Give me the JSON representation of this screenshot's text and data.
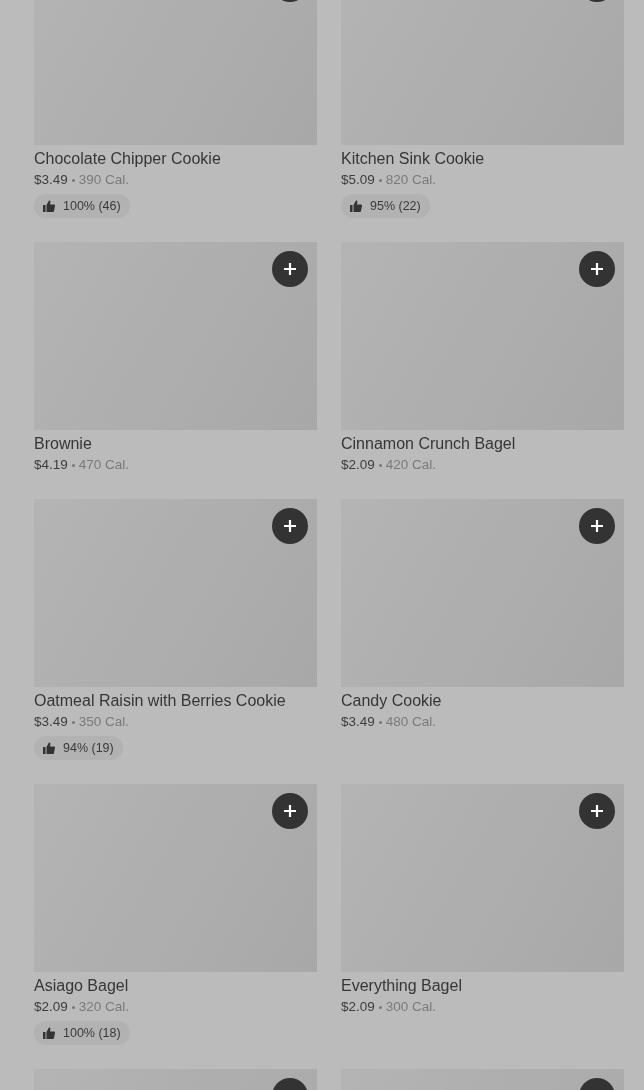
{
  "menu_items": [
    {
      "kind": "full",
      "name": "Chocolate Chipper Cookie",
      "price": "$3.49",
      "calories": "390 Cal.",
      "rating": "100% (46)"
    },
    {
      "kind": "full",
      "name": "Kitchen Sink Cookie",
      "price": "$5.09",
      "calories": "820 Cal.",
      "rating": "95% (22)"
    },
    {
      "kind": "full",
      "name": "Brownie",
      "price": "$4.19",
      "calories": "470 Cal."
    },
    {
      "kind": "full",
      "name": "Cinnamon Crunch Bagel",
      "price": "$2.09",
      "calories": "420 Cal."
    },
    {
      "kind": "full",
      "name": "Oatmeal Raisin with Berries Cookie",
      "price": "$3.49",
      "calories": "350 Cal.",
      "rating": "94% (19)"
    },
    {
      "kind": "full",
      "name": "Candy Cookie",
      "price": "$3.49",
      "calories": "480 Cal."
    },
    {
      "kind": "full",
      "name": "Asiago Bagel",
      "price": "$2.09",
      "calories": "320 Cal.",
      "rating": "100% (18)"
    },
    {
      "kind": "full",
      "name": "Everything Bagel",
      "price": "$2.09",
      "calories": "300 Cal."
    },
    {
      "kind": "cut"
    },
    {
      "kind": "cut"
    }
  ]
}
